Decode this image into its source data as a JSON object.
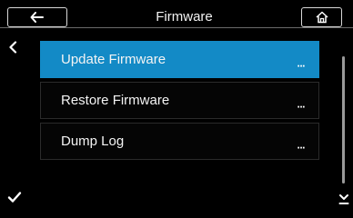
{
  "header": {
    "title": "Firmware",
    "back_icon": "back-arrow-icon",
    "home_icon": "home-icon"
  },
  "sidebar": {
    "back_icon": "chevron-left-icon",
    "confirm_icon": "checkmark-icon",
    "scroll_down_icon": "chevron-down-icon"
  },
  "menu": {
    "items": [
      {
        "label": "Update Firmware",
        "more": "...",
        "selected": true
      },
      {
        "label": "Restore Firmware",
        "more": "...",
        "selected": false
      },
      {
        "label": "Dump Log",
        "more": "...",
        "selected": false
      }
    ]
  },
  "colors": {
    "background": "#000000",
    "accent": "#138ac6",
    "text": "#ffffff",
    "border": "#d8d8d8"
  }
}
